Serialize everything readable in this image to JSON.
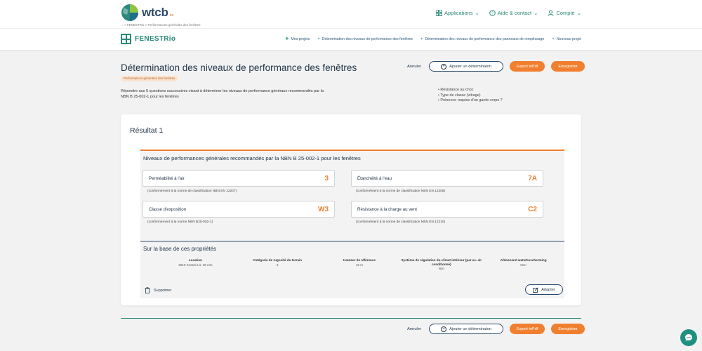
{
  "header": {
    "logo_text": "wtcb",
    "logo_sub": ".be",
    "nav": [
      {
        "label": "Applications",
        "icon": "grid-icon"
      },
      {
        "label": "Aide & contact",
        "icon": "help-circle-icon"
      },
      {
        "label": "Compte",
        "icon": "user-icon"
      }
    ],
    "breadcrumb": "⌂ > FENESTRio > Performances générales des fenêtres"
  },
  "app": {
    "name": "FENESTRio",
    "nav": [
      {
        "label": "Mes projets",
        "icon": "projects-icon"
      },
      {
        "label": "Détermination des niveaux de performance des fenêtres",
        "icon": "plus-icon"
      },
      {
        "label": "Détermination des niveaux de performance des panneaux de remplissage",
        "icon": "plus-icon"
      },
      {
        "label": "Nouveau projet",
        "icon": "plus-icon"
      }
    ]
  },
  "page": {
    "title": "Détermination des niveaux de performance des fenêtres",
    "tag": "Performances générales des fenêtres",
    "intro": "Répondre aux 5 questions successives visant à déterminer les niveaux de performance généraux recommandés par la NBN B 25-002-1 pour les fenêtres",
    "bullets": [
      "Résistance au choc",
      "Type de classe (vitrage)",
      "Présence requise d'un garde-corps ?"
    ]
  },
  "actions": {
    "cancel": "Annuler",
    "add": "Ajouter un déterminaton",
    "export": "Export toPdf",
    "save": "Enregistrer"
  },
  "result": {
    "title": "Résultat 1",
    "heading": "Niveaux de performances générales recommandés par la NBN B 25-002-1 pour les fenêtres",
    "items": [
      {
        "label": "Perméabilité à l'air",
        "value": "3",
        "note": "(conformément à la norme de classification NBN EN 12207)"
      },
      {
        "label": "Étanchéité à l'eau",
        "value": "7A",
        "note": "(conformément à la norme de classification NBN EN 12208)"
      },
      {
        "label": "Classe d'exposition",
        "value": "W3",
        "note": "(conformément à la norme NBN B25-002-1)"
      },
      {
        "label": "Résistance à la charge au vent",
        "value": "C2",
        "note": "(conformément à la norme de classification NBN EN 12210)"
      }
    ],
    "props_heading": "Sur la base de ces propriétés",
    "props": [
      {
        "label": "Location",
        "value": "3010 Kessel-Lo: 25 m/s"
      },
      {
        "label": "Catégorie de rugosité du terrain",
        "value": "3"
      },
      {
        "label": "Hauteur de référence",
        "value": "15 m"
      },
      {
        "label": "Système de régulation du climat intérieur (par ex. air conditionné)",
        "value": "Non"
      },
      {
        "label": "Afdoenend waterbescherming",
        "value": "Non"
      }
    ],
    "delete": "Supprimer",
    "adapt": "Adapter"
  },
  "colors": {
    "accent": "#f07f2f",
    "teal": "#2a8a7c",
    "navy": "#1f3347"
  }
}
